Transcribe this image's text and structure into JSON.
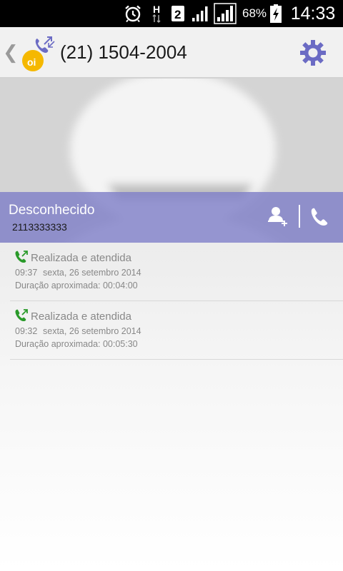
{
  "status_bar": {
    "battery_percent_text": "68%",
    "time": "14:33",
    "icons": [
      "alarm-icon",
      "network-h-icon",
      "sim-2-icon",
      "signal-icon",
      "signal-icon",
      "battery-charging-icon"
    ]
  },
  "header": {
    "title": "(21) 1504-2004",
    "logo_text": "oi",
    "back_icon": "chevron-left-icon",
    "settings_icon": "gear-icon"
  },
  "contact": {
    "name": "Desconhecido",
    "number": "2113333333",
    "add_contact_icon": "add-contact-icon",
    "call_icon": "phone-icon"
  },
  "call_log": [
    {
      "type": "Realizada e atendida",
      "time": "09:37",
      "date": "sexta, 26 setembro 2014",
      "duration": "Duração aproximada: 00:04:00"
    },
    {
      "type": "Realizada e atendida",
      "time": "09:32",
      "date": "sexta, 26 setembro 2014",
      "duration": "Duração aproximada: 00:05:30"
    }
  ],
  "colors": {
    "accent": "#7f7fc8",
    "call_icon_green": "#2a9a2a",
    "logo_yellow": "#f5b800",
    "logo_phone": "#6b6bc4"
  }
}
